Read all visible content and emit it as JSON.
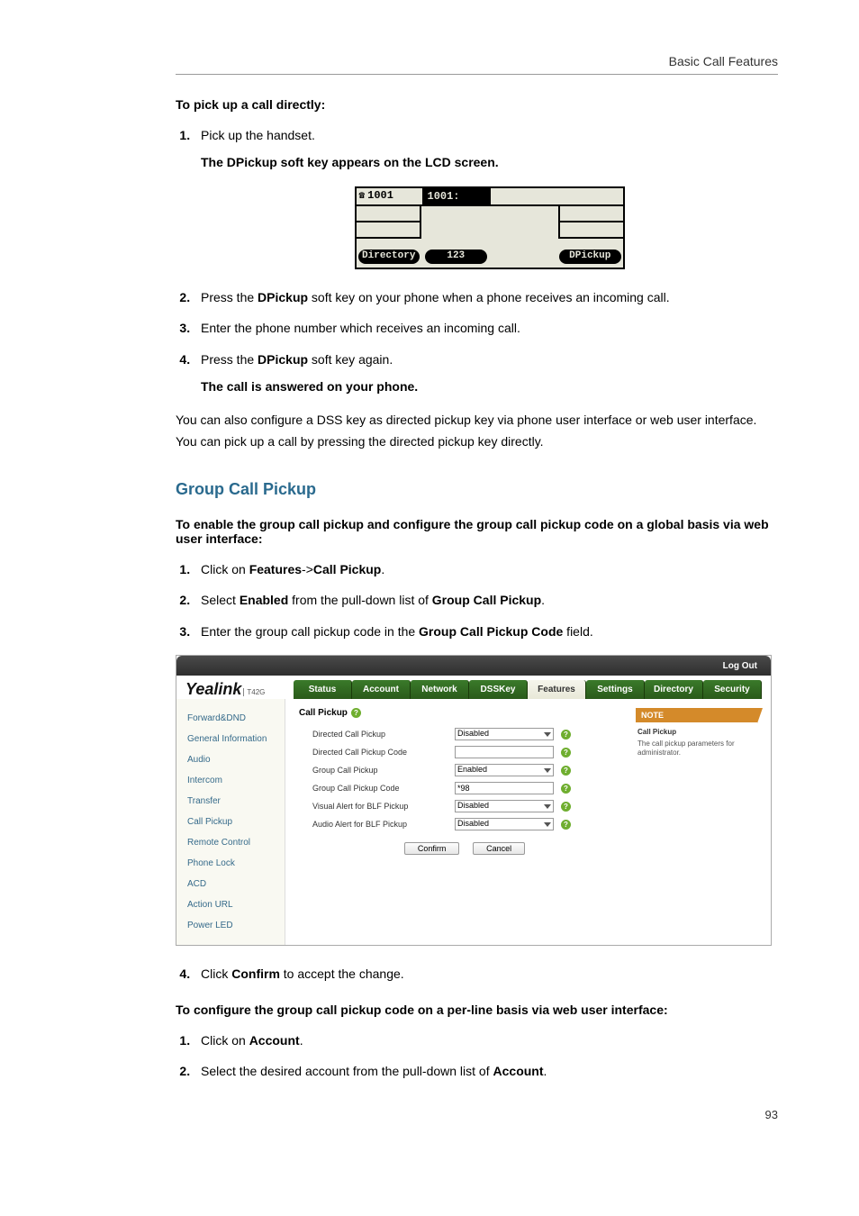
{
  "header": {
    "title": "Basic Call Features"
  },
  "sec1": {
    "title": "To pick up a call directly:",
    "steps": [
      {
        "pre": "Pick up the handset.",
        "sub": "The ",
        "sub_bold": "DPickup",
        "sub_after": " soft key appears on the LCD screen."
      },
      {
        "pre": "Press the ",
        "bold": "DPickup",
        "post": " soft key on your phone when a phone receives an incoming call."
      },
      {
        "pre": "Enter the phone number which receives an incoming call."
      },
      {
        "pre": "Press the ",
        "bold": "DPickup",
        "post": " soft key again.",
        "sub_plain": "The call is answered on your phone."
      }
    ],
    "after": "You can also configure a DSS key as directed pickup key via phone user interface or web user interface. You can pick up a call by pressing the directed pickup key directly."
  },
  "lcd": {
    "ext": "1001",
    "title": "1001:",
    "soft1": "Directory",
    "soft2": "123",
    "soft4": "DPickup"
  },
  "group": {
    "heading": "Group Call Pickup",
    "intro": "To enable the group call pickup and configure the group call pickup code on a global basis via web user interface:",
    "steps": [
      {
        "pre": "Click on ",
        "bold": "Features",
        "mid": "->",
        "bold2": "Call Pickup",
        "post": "."
      },
      {
        "pre": "Select ",
        "bold": "Enabled",
        "mid": " from the pull-down list of ",
        "bold2": "Group Call Pickup",
        "post": "."
      },
      {
        "pre": "Enter the group call pickup code in the ",
        "bold": "Group Call Pickup Code",
        "post": " field."
      }
    ],
    "step4": {
      "pre": "Click ",
      "bold": "Confirm",
      "post": " to accept the change."
    },
    "perline_title": "To configure the group call pickup code on a per-line basis via web user interface:",
    "perline_steps": [
      {
        "pre": "Click on ",
        "bold": "Account",
        "post": "."
      },
      {
        "pre": "Select the desired account from the pull-down list of ",
        "bold": "Account",
        "post": "."
      }
    ]
  },
  "web": {
    "logout": "Log Out",
    "logo": "Yealink",
    "model": "T42G",
    "tabs": [
      "Status",
      "Account",
      "Network",
      "DSSKey",
      "Features",
      "Settings",
      "Directory",
      "Security"
    ],
    "tabs_active": 4,
    "side": [
      "Forward&DND",
      "General Information",
      "Audio",
      "Intercom",
      "Transfer",
      "Call Pickup",
      "Remote Control",
      "Phone Lock",
      "ACD",
      "Action URL",
      "Power LED"
    ],
    "side_active": 5,
    "panel_title": "Call Pickup",
    "rows": [
      {
        "label": "Directed Call Pickup",
        "type": "select",
        "value": "Disabled"
      },
      {
        "label": "Directed Call Pickup Code",
        "type": "text",
        "value": ""
      },
      {
        "label": "Group Call Pickup",
        "type": "select",
        "value": "Enabled"
      },
      {
        "label": "Group Call Pickup Code",
        "type": "text",
        "value": "*98"
      },
      {
        "label": "Visual Alert for BLF Pickup",
        "type": "select",
        "value": "Disabled"
      },
      {
        "label": "Audio Alert for BLF Pickup",
        "type": "select",
        "value": "Disabled"
      }
    ],
    "confirm": "Confirm",
    "cancel": "Cancel",
    "note_head": "NOTE",
    "note_title": "Call Pickup",
    "note_body": "The call pickup parameters for administrator."
  },
  "page_number": "93"
}
